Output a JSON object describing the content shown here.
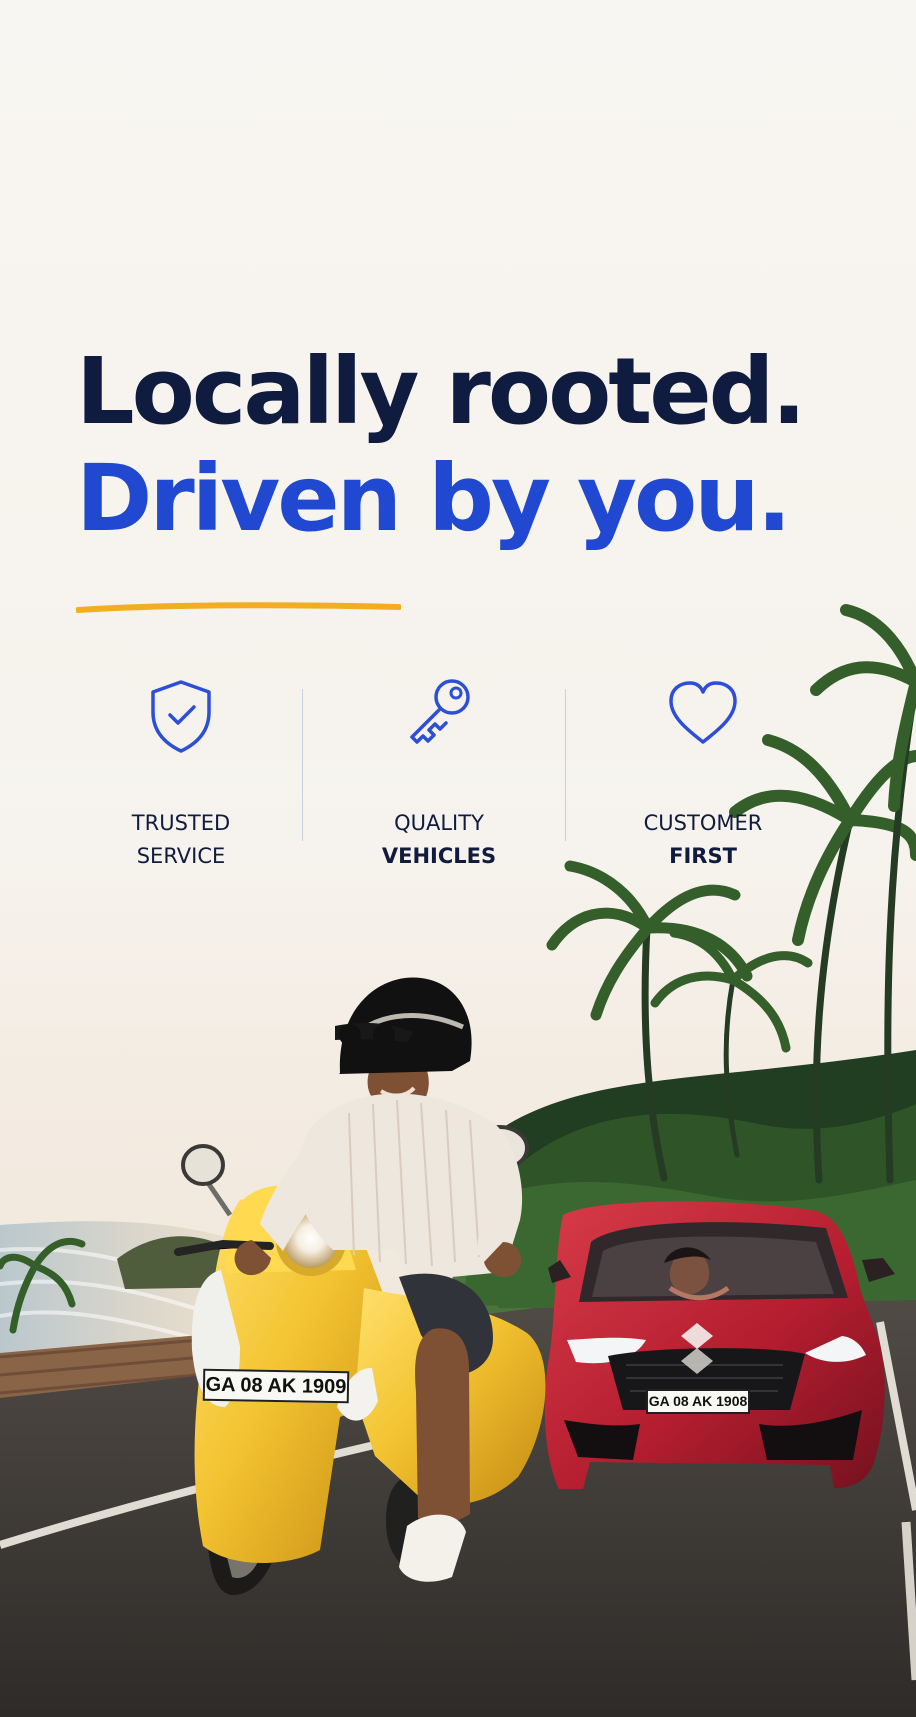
{
  "headline": {
    "line1": "Locally rooted.",
    "line2": "Driven by you."
  },
  "colors": {
    "navy": "#0f1b3f",
    "blue": "#2048d0",
    "accent": "#f2ad21",
    "divider": "#c9d0dc"
  },
  "features": [
    {
      "icon": "shield-check-icon",
      "line1": "TRUSTED",
      "line2": "SERVICE"
    },
    {
      "icon": "key-icon",
      "line1": "QUALITY",
      "line2": "VEHICLES"
    },
    {
      "icon": "heart-icon",
      "line1": "CUSTOMER",
      "line2": "FIRST"
    }
  ],
  "vehicles": {
    "scooter_plate": "GA 08 AK 1909",
    "car_plate": "GA 08 AK 1908"
  }
}
